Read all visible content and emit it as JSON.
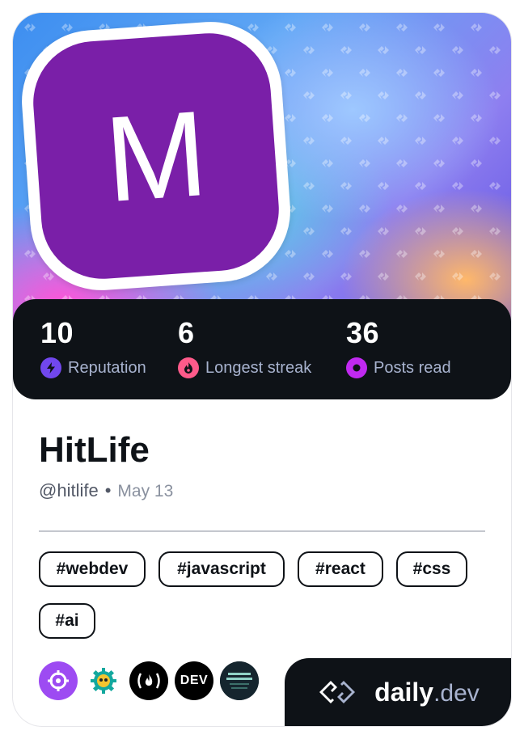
{
  "profile": {
    "avatar_letter": "M",
    "name": "HitLife",
    "handle": "@hitlife",
    "separator": "•",
    "joined": "May 13"
  },
  "stats": [
    {
      "value": "10",
      "label": "Reputation",
      "icon": "bolt-icon",
      "color": "#7147ed"
    },
    {
      "value": "6",
      "label": "Longest streak",
      "icon": "flame-icon",
      "color": "#ff5a8a"
    },
    {
      "value": "36",
      "label": "Posts read",
      "icon": "eye-icon",
      "color": "#c029f0"
    }
  ],
  "tags": [
    "#webdev",
    "#javascript",
    "#react",
    "#css",
    "#ai"
  ],
  "sources": [
    {
      "name": "crosshair-source-icon",
      "bg": "#9d4bf2"
    },
    {
      "name": "gear-owl-source-icon",
      "bg": "#ffffff"
    },
    {
      "name": "freecodecamp-source-icon",
      "bg": "#000000",
      "text": "(🔥)"
    },
    {
      "name": "dev-source-icon",
      "bg": "#000000",
      "text": "DEV"
    },
    {
      "name": "thumbnail-source-icon",
      "bg": "#15252e"
    }
  ],
  "brand": {
    "daily": "daily",
    "dev": ".dev"
  },
  "colors": {
    "cover_base": "#3d8ef0",
    "avatar": "#7a1fa8",
    "dark": "#0e1217",
    "muted": "#a8b3cf"
  }
}
